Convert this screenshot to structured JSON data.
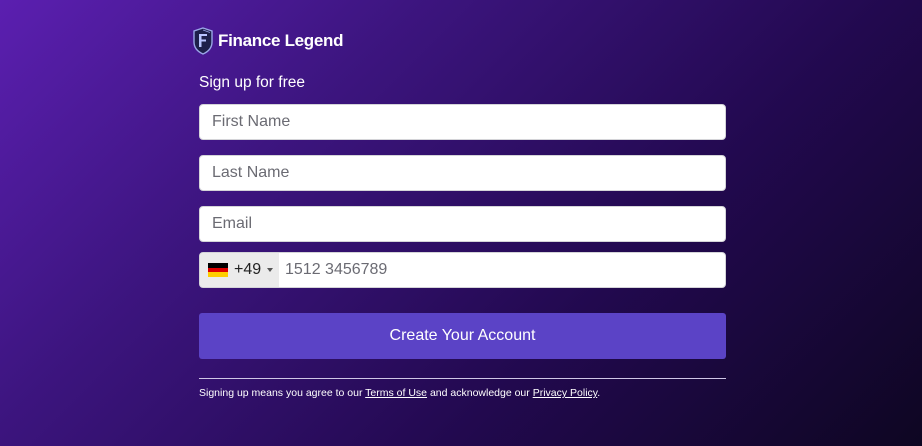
{
  "brand": {
    "name": "Finance Legend",
    "color": "#ffffff"
  },
  "form": {
    "heading": "Sign up for free",
    "first_name_placeholder": "First Name",
    "last_name_placeholder": "Last Name",
    "email_placeholder": "Email",
    "phone": {
      "country_flag": "germany-flag-icon",
      "dial_code": "+49",
      "placeholder": "1512 3456789"
    },
    "submit_label": "Create Your Account",
    "submit_color": "#5b43c6"
  },
  "legal": {
    "prefix": "Signing up means you agree to our ",
    "terms_label": "Terms of Use",
    "middle": " and acknowledge our ",
    "privacy_label": "Privacy Policy",
    "suffix": "."
  }
}
